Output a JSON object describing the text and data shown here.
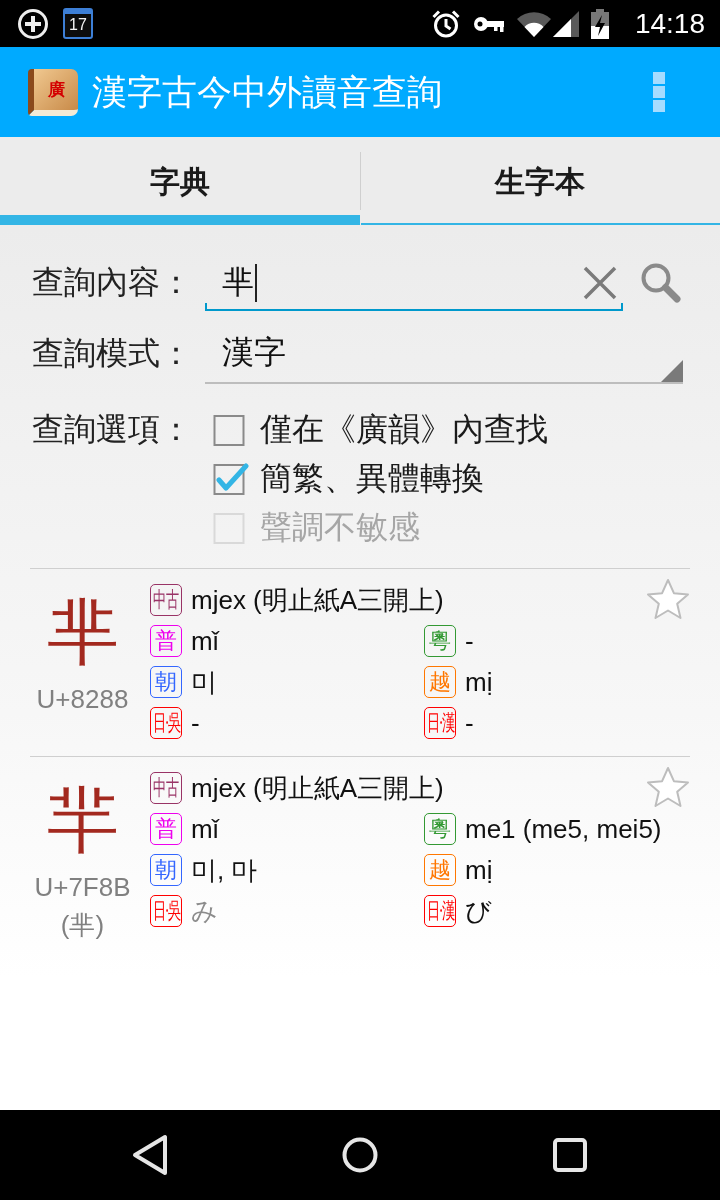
{
  "status_bar": {
    "calendar_day": "17",
    "time": "14:18"
  },
  "app_bar": {
    "logo_text": "廣",
    "title": "漢字古今中外讀音查詢"
  },
  "tabs": [
    {
      "label": "字典",
      "selected": true
    },
    {
      "label": "生字本",
      "selected": false
    }
  ],
  "query": {
    "label": "查詢內容：",
    "value": "芈"
  },
  "mode": {
    "label": "查詢模式：",
    "value": "漢字"
  },
  "options": {
    "label": "查詢選項：",
    "items": [
      {
        "label": "僅在《廣韻》內查找",
        "checked": false,
        "disabled": false
      },
      {
        "label": "簡繁、異體轉換",
        "checked": true,
        "disabled": false
      },
      {
        "label": "聲調不敏感",
        "checked": false,
        "disabled": true
      }
    ]
  },
  "results": [
    {
      "character": "芈",
      "code": "U+8288",
      "starred": false,
      "middle_chinese": {
        "tag": "中古",
        "color": "#993366",
        "text": "mjex (明止紙A三開上)",
        "dimmed": false
      },
      "readings": [
        {
          "tag": "普",
          "color": "#ee00ee",
          "text": "mǐ",
          "dimmed": false
        },
        {
          "tag": "粵",
          "color": "#339933",
          "text": "-",
          "dimmed": false
        },
        {
          "tag": "朝",
          "color": "#3366ff",
          "text": "미",
          "dimmed": false
        },
        {
          "tag": "越",
          "color": "#ff7700",
          "text": "mị",
          "dimmed": false
        },
        {
          "tag": "日·吳",
          "color": "#ff0000",
          "text": "-",
          "dimmed": false
        },
        {
          "tag": "日·漢",
          "color": "#ff0000",
          "text": "-",
          "dimmed": false
        }
      ]
    },
    {
      "character": "羋",
      "code": "U+7F8B",
      "variant": "(芈)",
      "starred": false,
      "middle_chinese": {
        "tag": "中古",
        "color": "#993366",
        "text": "mjex (明止紙A三開上)",
        "dimmed": false
      },
      "readings": [
        {
          "tag": "普",
          "color": "#ee00ee",
          "text": "mǐ",
          "dimmed": false
        },
        {
          "tag": "粵",
          "color": "#339933",
          "text": "me1 (me5, mei5)",
          "dimmed": false
        },
        {
          "tag": "朝",
          "color": "#3366ff",
          "text": "미, 마",
          "dimmed": false
        },
        {
          "tag": "越",
          "color": "#ff7700",
          "text": "mị",
          "dimmed": false
        },
        {
          "tag": "日·吳",
          "color": "#ff0000",
          "text": "み",
          "dimmed": true
        },
        {
          "tag": "日·漢",
          "color": "#ff0000",
          "text": "び",
          "dimmed": false
        }
      ]
    }
  ]
}
